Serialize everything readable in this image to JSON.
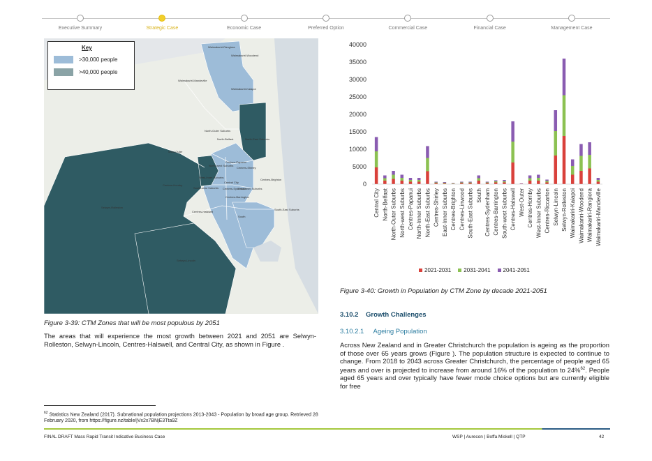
{
  "stepper": {
    "steps": [
      "Executive Summary",
      "Strategic Case",
      "Economic Case",
      "Preferred Option",
      "Commercial Case",
      "Financial Case",
      "Management Case"
    ],
    "active_index": 1,
    "active_color": "#f2cf2b"
  },
  "map": {
    "legend_title": "Key",
    "legend_items": [
      {
        "label": ">30,000 people",
        "color": "#9dbcd8"
      },
      {
        "label": ">40,000 people",
        "color": "#8aa3a6"
      }
    ],
    "dark_zone_color": "#2f5b63",
    "light_zone_color": "#9dbcd8",
    "labels": [
      "Waimakariri-Rangiora",
      "Waimakariri-Woodend",
      "Waimakariri-Mandeville",
      "Waimakariri-Kaiapoi",
      "North-Outer Suburbs",
      "North-Belfast",
      "North-East Suburbs",
      "West-Outer",
      "Centres-Papanui",
      "North-west Suburbs",
      "Centres-Shirley",
      "Centres-Brighton",
      "West-Inner Suburbs",
      "Central City",
      "Centres-Hornby",
      "South-west Suburbs",
      "Centres-Sydenham",
      "East-Inner Suburbs",
      "Centres-Barrington",
      "Centres-Halswell",
      "South-East Suburbs",
      "Selwyn-Rolleston",
      "South",
      "Selwyn-Lincoln"
    ]
  },
  "fig39_caption": "Figure 3-39: CTM Zones that will be most populous by 2051",
  "left_paragraph": "The areas that will experience the most growth between 2021 and 2051 are Selwyn-Rolleston, Selwyn-Lincoln, Centres-Halswell, and Central City, as shown in Figure .",
  "footnote": {
    "num": "62",
    "text": " Statistics New Zealand (2017). Subnational population projections 2013-2043 - Population by broad age group. Retrieved 28 February 2020, from https://figure.nz/table/jVx2x7BNjE3Tta9Z"
  },
  "chart_data": {
    "type": "bar",
    "stacked": true,
    "categories": [
      "Central City",
      "North-Belfast",
      "North-Outer Suburbs",
      "North-west Suburbs",
      "Centres-Papanui",
      "North-Inner Suburbs",
      "North-East Suburbs",
      "Centres-Shirley",
      "East-Inner Suburbs",
      "Centres-Brighton",
      "Centres-Linwood",
      "South-East Suburbs",
      "South",
      "Centres-Sydenham",
      "Centres-Barrington",
      "South-west Suburbs",
      "Centres-Halswell",
      "West-Outer",
      "Centres-Hornby",
      "West-Inner Suburbs",
      "Centres-Riccarton",
      "Selwyn-Lincoln",
      "Selwyn-Rolleston",
      "Waimakariri-Kaiapoi",
      "Waimakariri-Woodend",
      "Waimakariri-Rangiora",
      "Waimakariri-Mandeville"
    ],
    "series": [
      {
        "name": "2021-2031",
        "color": "#d9413b",
        "values": [
          4800,
          1000,
          1500,
          1000,
          700,
          700,
          3700,
          300,
          200,
          100,
          300,
          300,
          1000,
          300,
          500,
          500,
          6200,
          100,
          1000,
          1000,
          500,
          8200,
          13800,
          2700,
          3800,
          4500,
          700
        ]
      },
      {
        "name": "2031-2041",
        "color": "#8cc152",
        "values": [
          4600,
          700,
          1200,
          800,
          500,
          500,
          3800,
          200,
          200,
          100,
          200,
          200,
          700,
          200,
          300,
          300,
          6000,
          0,
          700,
          800,
          400,
          7000,
          11700,
          2500,
          4300,
          3900,
          500
        ]
      },
      {
        "name": "2041-2051",
        "color": "#8a5cb1",
        "values": [
          4100,
          800,
          1100,
          900,
          600,
          600,
          3400,
          200,
          200,
          100,
          200,
          200,
          800,
          200,
          300,
          400,
          5800,
          100,
          800,
          900,
          400,
          6000,
          10500,
          1900,
          3400,
          3600,
          600
        ]
      }
    ],
    "ylim": [
      0,
      40000
    ],
    "yticks": [
      "0",
      "5000",
      "10000",
      "15000",
      "20000",
      "25000",
      "30000",
      "35000",
      "40000"
    ],
    "legend_position": "bottom"
  },
  "fig40_caption": "Figure 3-40: Growth in Population by CTM Zone by decade 2021-2051",
  "section": {
    "num": "3.10.2",
    "title": "Growth Challenges"
  },
  "subsection": {
    "num": "3.10.2.1",
    "title": "Ageing Population"
  },
  "right_paragraph_a": "Across New Zealand and in Greater Christchurch the population is ageing as the proportion of those over 65 years grows (Figure ). The population structure is expected to continue to change. From 2018 to 2043 across Greater Christchurch, the percentage of people aged 65 years and over is projected to increase from around 16% of the population to 24%",
  "right_paragraph_sup": "62",
  "right_paragraph_b": ". People aged 65 years and over typically have fewer mode choice options but are currently eligible for free",
  "footer": {
    "left": "FINAL DRAFT Mass Rapid Transit Indicative Business Case",
    "right": "WSP | Aurecon | Boffa Miskell | QTP",
    "page": "42"
  }
}
